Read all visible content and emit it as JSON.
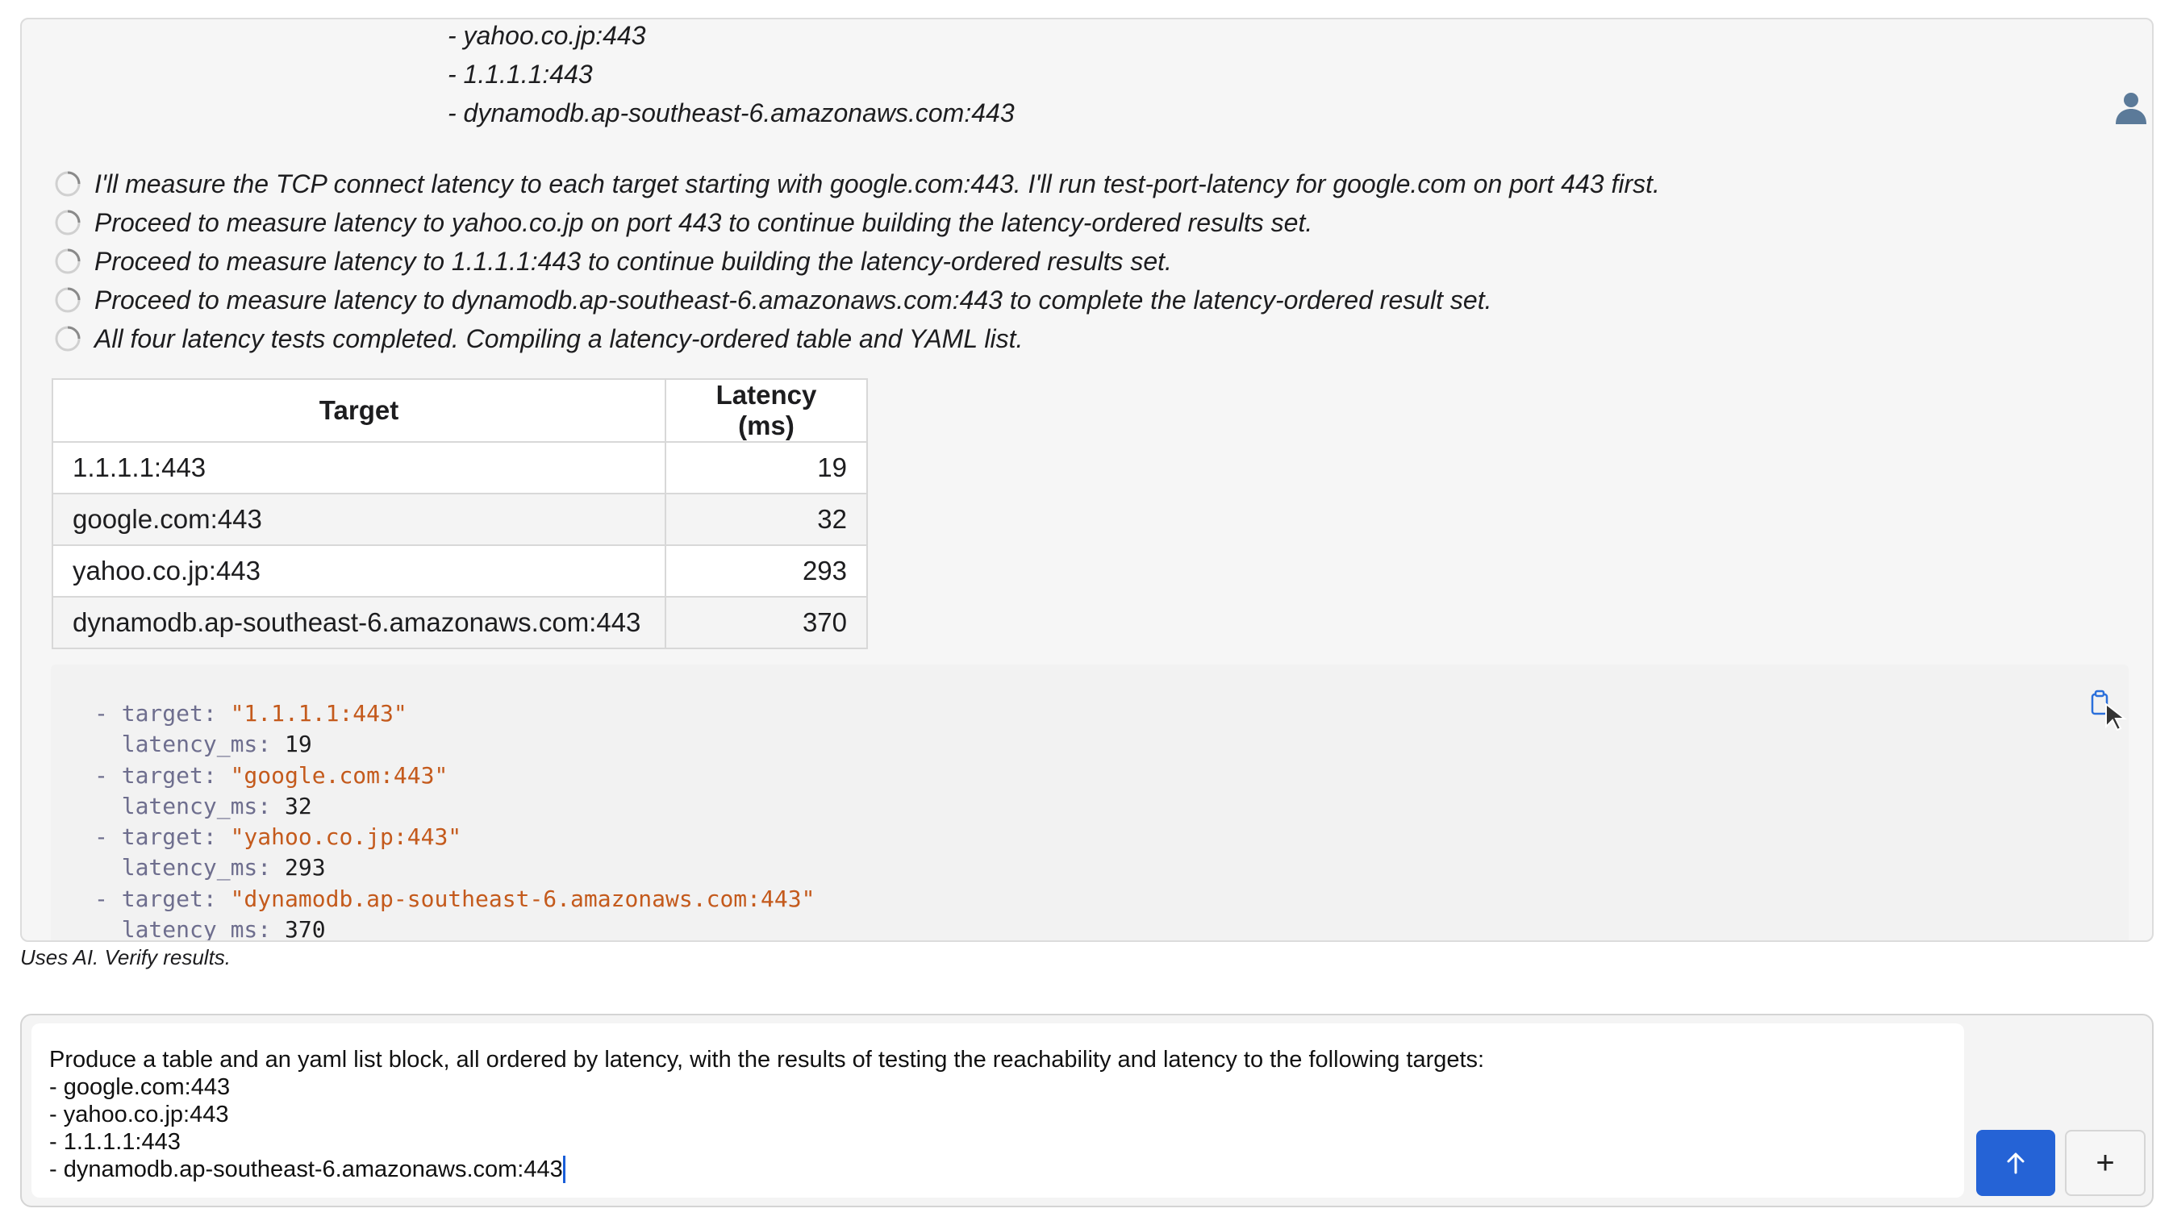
{
  "user_message": {
    "lines": [
      "- yahoo.co.jp:443",
      "- 1.1.1.1:443",
      "- dynamodb.ap-southeast-6.amazonaws.com:443"
    ]
  },
  "steps": [
    "I'll measure the TCP connect latency to each target starting with google.com:443. I'll run test-port-latency for google.com on port 443 first.",
    "Proceed to measure latency to yahoo.co.jp on port 443 to continue building the latency-ordered results set.",
    "Proceed to measure latency to 1.1.1.1:443 to continue building the latency-ordered results set.",
    "Proceed to measure latency to dynamodb.ap-southeast-6.amazonaws.com:443 to complete the latency-ordered result set.",
    "All four latency tests completed. Compiling a latency-ordered table and YAML list."
  ],
  "table": {
    "headers": [
      "Target",
      "Latency (ms)"
    ],
    "rows": [
      {
        "target": "1.1.1.1:443",
        "latency": "19"
      },
      {
        "target": "google.com:443",
        "latency": "32"
      },
      {
        "target": "yahoo.co.jp:443",
        "latency": "293"
      },
      {
        "target": "dynamodb.ap-southeast-6.amazonaws.com:443",
        "latency": "370"
      }
    ]
  },
  "yaml": {
    "dash": "- ",
    "target_key": "target: ",
    "latency_key": "latency_ms: ",
    "items": [
      {
        "target": "\"1.1.1.1:443\"",
        "latency": "19"
      },
      {
        "target": "\"google.com:443\"",
        "latency": "32"
      },
      {
        "target": "\"yahoo.co.jp:443\"",
        "latency": "293"
      },
      {
        "target": "\"dynamodb.ap-southeast-6.amazonaws.com:443\"",
        "latency": "370"
      }
    ]
  },
  "disclaimer": "Uses AI. Verify results.",
  "composer": {
    "lines": [
      "Produce a table and an yaml list block, all ordered by latency, with the results of testing the reachability and latency to the following targets:",
      "- google.com:443",
      "- yahoo.co.jp:443",
      "- 1.1.1.1:443",
      "- dynamodb.ap-southeast-6.amazonaws.com:443"
    ],
    "add_label": "+"
  },
  "colors": {
    "send_button": "#2563d6",
    "yaml_string": "#c45a1c",
    "yaml_key": "#6e6e8e"
  },
  "icons": {
    "avatar": "user-avatar-icon",
    "spinner": "spinner-icon",
    "copy": "clipboard-icon",
    "send": "arrow-up-icon",
    "add": "plus-icon"
  }
}
